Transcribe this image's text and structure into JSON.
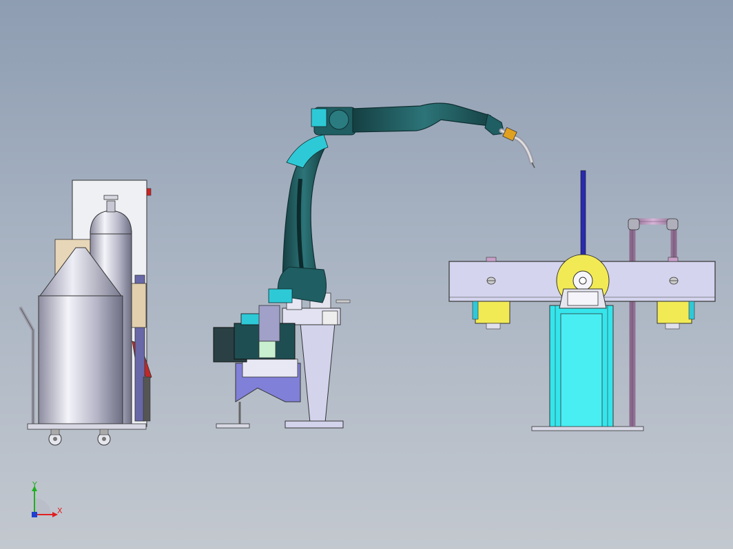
{
  "triad": {
    "x_label": "X",
    "y_label": "Y",
    "x_color": "#e02020",
    "y_color": "#20b020",
    "z_color": "#2040d0"
  },
  "colors": {
    "robot_teal": "#1f5e62",
    "robot_cyan": "#2ec9d6",
    "stand_lavender": "#d3d3ec",
    "positioner_cyan": "#35e5ec",
    "bracket_yellow": "#f2ea55",
    "pipe_mauve": "#b48bb6",
    "cylinder_grey": "#b9b9c8",
    "base_purple": "#8080d8"
  }
}
